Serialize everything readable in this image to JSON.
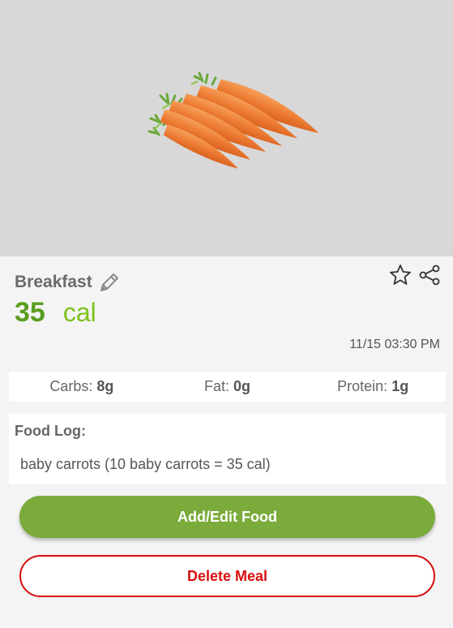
{
  "photo": {
    "subject": "baby carrots",
    "background_color": "#d8d8d8"
  },
  "meal": {
    "name": "Breakfast",
    "calories": "35",
    "calorie_unit": "cal",
    "timestamp": "11/15 03:30 PM"
  },
  "icons": {
    "edit": "pencil-icon",
    "favorite": "star-outline-icon",
    "share": "share-icon"
  },
  "macros": {
    "carbs_label": "Carbs:",
    "carbs_value": "8g",
    "fat_label": "Fat:",
    "fat_value": "0g",
    "protein_label": "Protein:",
    "protein_value": "1g"
  },
  "food_log": {
    "title": "Food Log:",
    "entries": [
      "baby carrots (10 baby carrots = 35 cal)"
    ]
  },
  "actions": {
    "add_edit_label": "Add/Edit Food",
    "delete_label": "Delete Meal"
  },
  "colors": {
    "calorie_value": "#5a9e1e",
    "calorie_unit": "#7cc21d",
    "add_button": "#7aab3b",
    "delete_accent": "#d70e0e",
    "page_background": "#f4f4f4"
  }
}
